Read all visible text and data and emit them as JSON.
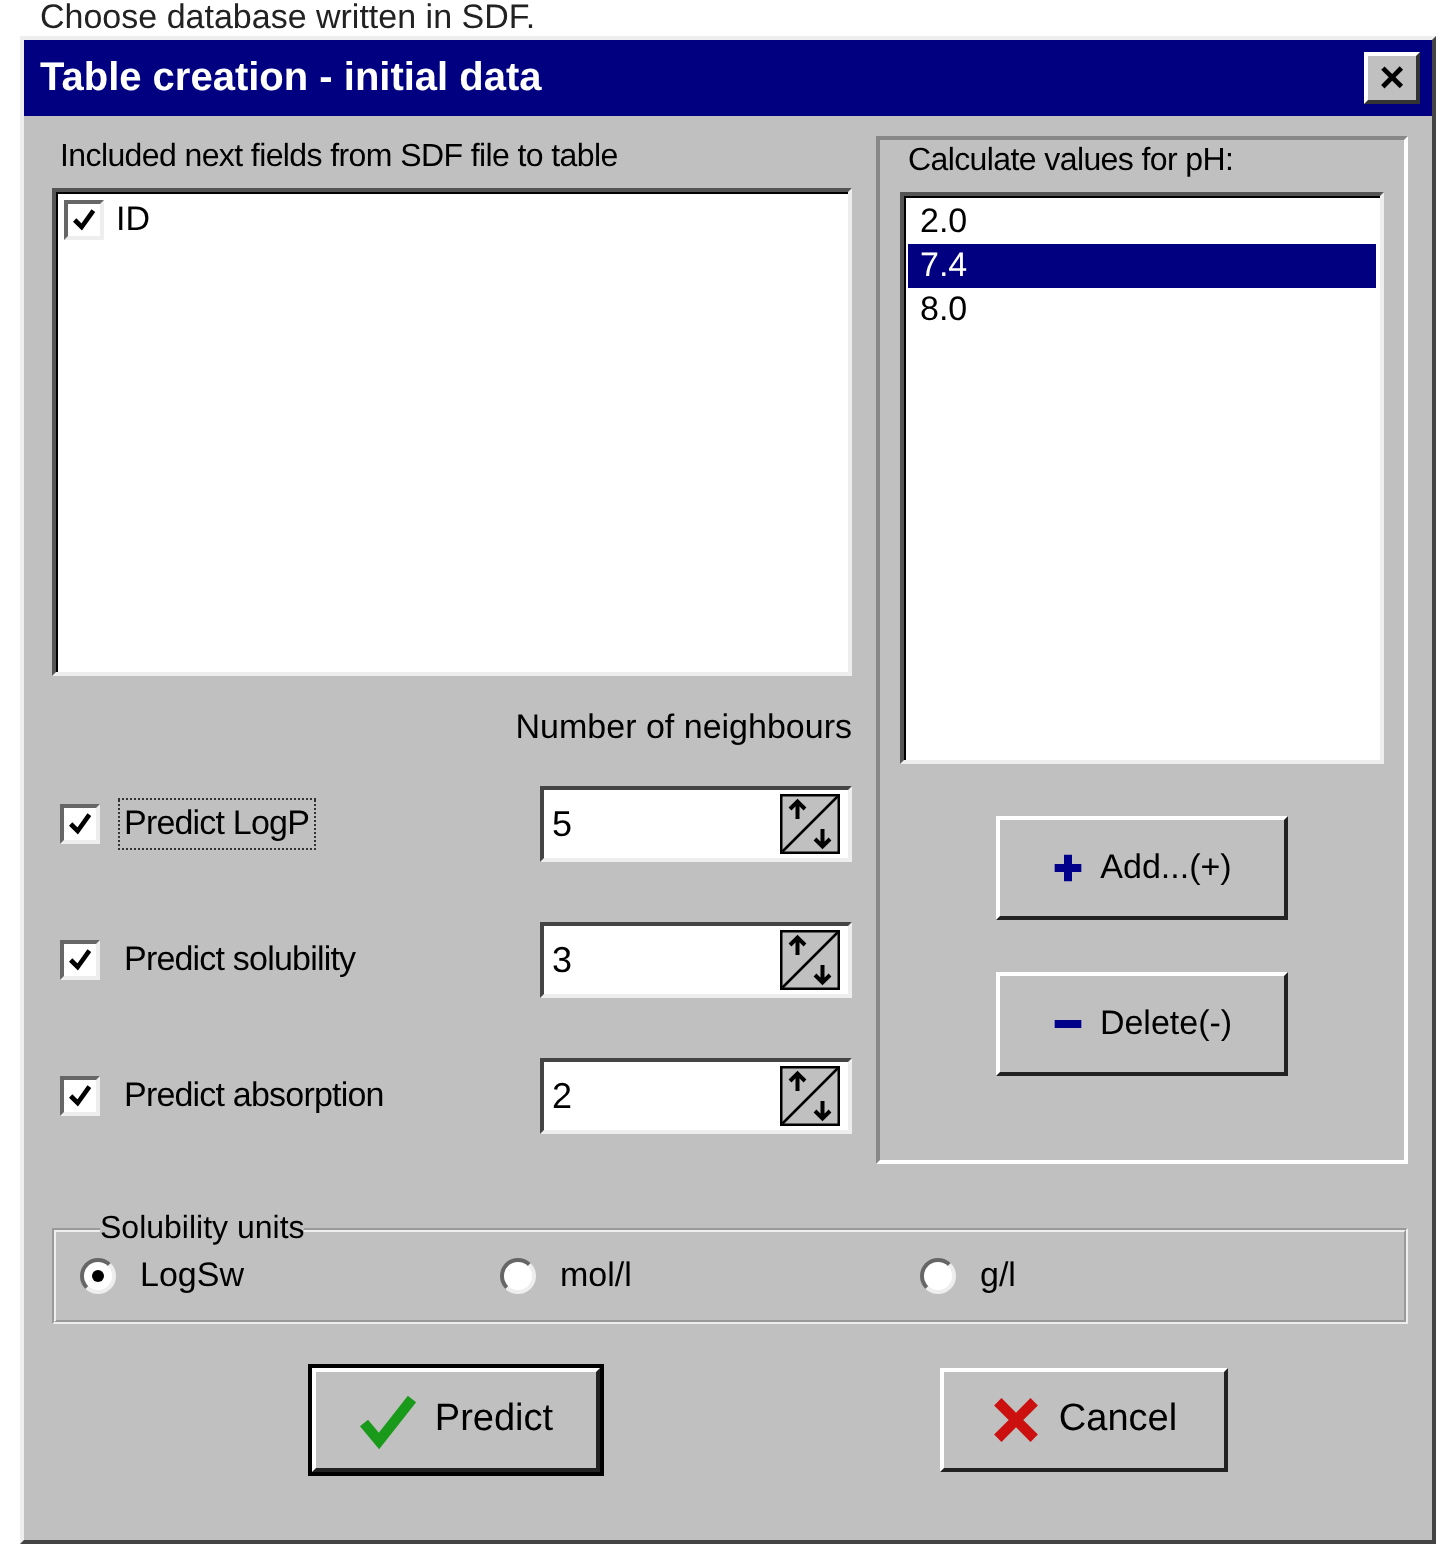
{
  "caption": "Choose database written in SDF.",
  "window": {
    "title": "Table creation - initial data",
    "close": "×"
  },
  "fields_group": {
    "label": "Included next fields from SDF file to table",
    "items": [
      {
        "label": "ID",
        "checked": true
      }
    ]
  },
  "neighbours_label": "Number of neighbours",
  "predictions": [
    {
      "label": "Predict LogP",
      "checked": true,
      "value": "5"
    },
    {
      "label": "Predict solubility",
      "checked": true,
      "value": "3"
    },
    {
      "label": "Predict absorption",
      "checked": true,
      "value": "2"
    }
  ],
  "ph_group": {
    "label": "Calculate values for pH:",
    "items": [
      {
        "label": "2.0",
        "selected": false
      },
      {
        "label": "7.4",
        "selected": true
      },
      {
        "label": "8.0",
        "selected": false
      }
    ],
    "buttons": [
      {
        "kind": "add",
        "label": "Add...(+)"
      },
      {
        "kind": "delete",
        "label": "Delete(-)"
      }
    ]
  },
  "solubility_units": {
    "label": "Solubility units",
    "options": [
      {
        "label": "LogSw",
        "selected": true
      },
      {
        "label": "mol/l",
        "selected": false
      },
      {
        "label": "g/l",
        "selected": false
      }
    ]
  },
  "buttons": [
    {
      "kind": "ok",
      "label": "Predict"
    },
    {
      "kind": "cancel",
      "label": "Cancel"
    }
  ]
}
